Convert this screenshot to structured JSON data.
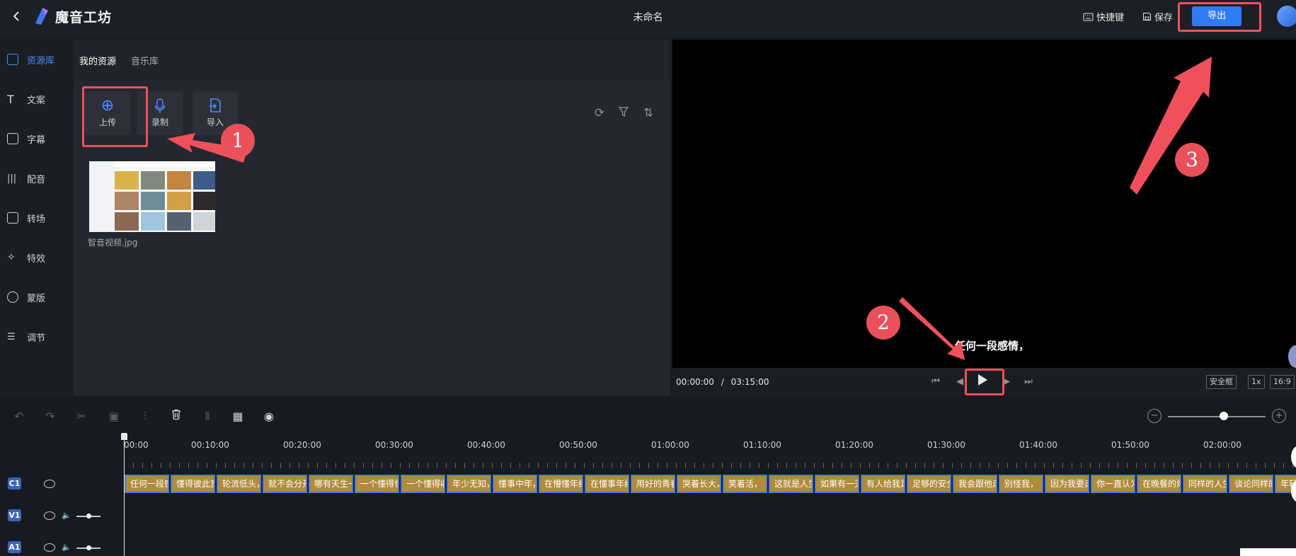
{
  "header": {
    "back_icon": "chevron-left-icon",
    "app_name": "魔音工坊",
    "doc_title": "未命名",
    "shortcut_label": "快捷键",
    "save_label": "保存",
    "export_label": "导出"
  },
  "sidebar": {
    "items": [
      {
        "label": "资源库",
        "icon": "library-icon",
        "active": true
      },
      {
        "label": "文案",
        "icon": "text-icon"
      },
      {
        "label": "字幕",
        "icon": "subtitle-icon"
      },
      {
        "label": "配音",
        "icon": "audio-wave-icon"
      },
      {
        "label": "转场",
        "icon": "transition-icon"
      },
      {
        "label": "特效",
        "icon": "effects-icon"
      },
      {
        "label": "蒙版",
        "icon": "mask-icon"
      },
      {
        "label": "调节",
        "icon": "adjust-icon"
      }
    ]
  },
  "resources": {
    "tabs": [
      "我的资源",
      "音乐库"
    ],
    "tools": [
      {
        "label": "上传",
        "icon": "upload-plus-icon"
      },
      {
        "label": "录制",
        "icon": "microphone-icon"
      },
      {
        "label": "导入",
        "icon": "import-icon"
      }
    ],
    "file_name": "智音视频.jpg"
  },
  "preview": {
    "subtitle_text": "任何一段感情，",
    "current_time": "00:00:00",
    "separator": "/",
    "total_time": "03:15:00",
    "safe_frame_label": "安全框",
    "speed_label": "1x",
    "ratio_label": "16:9"
  },
  "timeline": {
    "ruler_labels": [
      "00:00",
      "00:10:00",
      "00:20:00",
      "00:30:00",
      "00:40:00",
      "00:50:00",
      "01:00:00",
      "01:10:00",
      "01:20:00",
      "01:30:00",
      "01:40:00",
      "01:50:00",
      "02:00:00"
    ],
    "tracks": [
      {
        "id": "C1"
      },
      {
        "id": "V1"
      },
      {
        "id": "A1"
      }
    ],
    "captions": [
      "任何一段感",
      "懂得彼此宽",
      "轮流低头，",
      "就不会分开",
      "哪有天生一",
      "一个懂得包",
      "一个懂得收",
      "年少无知，",
      "懂事中年，",
      "在懵懂年纪",
      "在懂事年纪",
      "用好的青春",
      "哭着长大，",
      "笑着活，",
      "这就是人生",
      "如果有一天",
      "有人给我足",
      "足够的安全",
      "我会跟他走",
      "别怪我，",
      "因为我要走",
      "你一直认为",
      "在晚餐的灯",
      "同样的人生",
      "谈论同样的",
      "年轻"
    ]
  },
  "annotations": {
    "markers": [
      "1",
      "2",
      "3"
    ]
  },
  "colors": {
    "accent": "#2f7bf5",
    "highlight": "#f0505c",
    "caption": "#b08a3e"
  }
}
